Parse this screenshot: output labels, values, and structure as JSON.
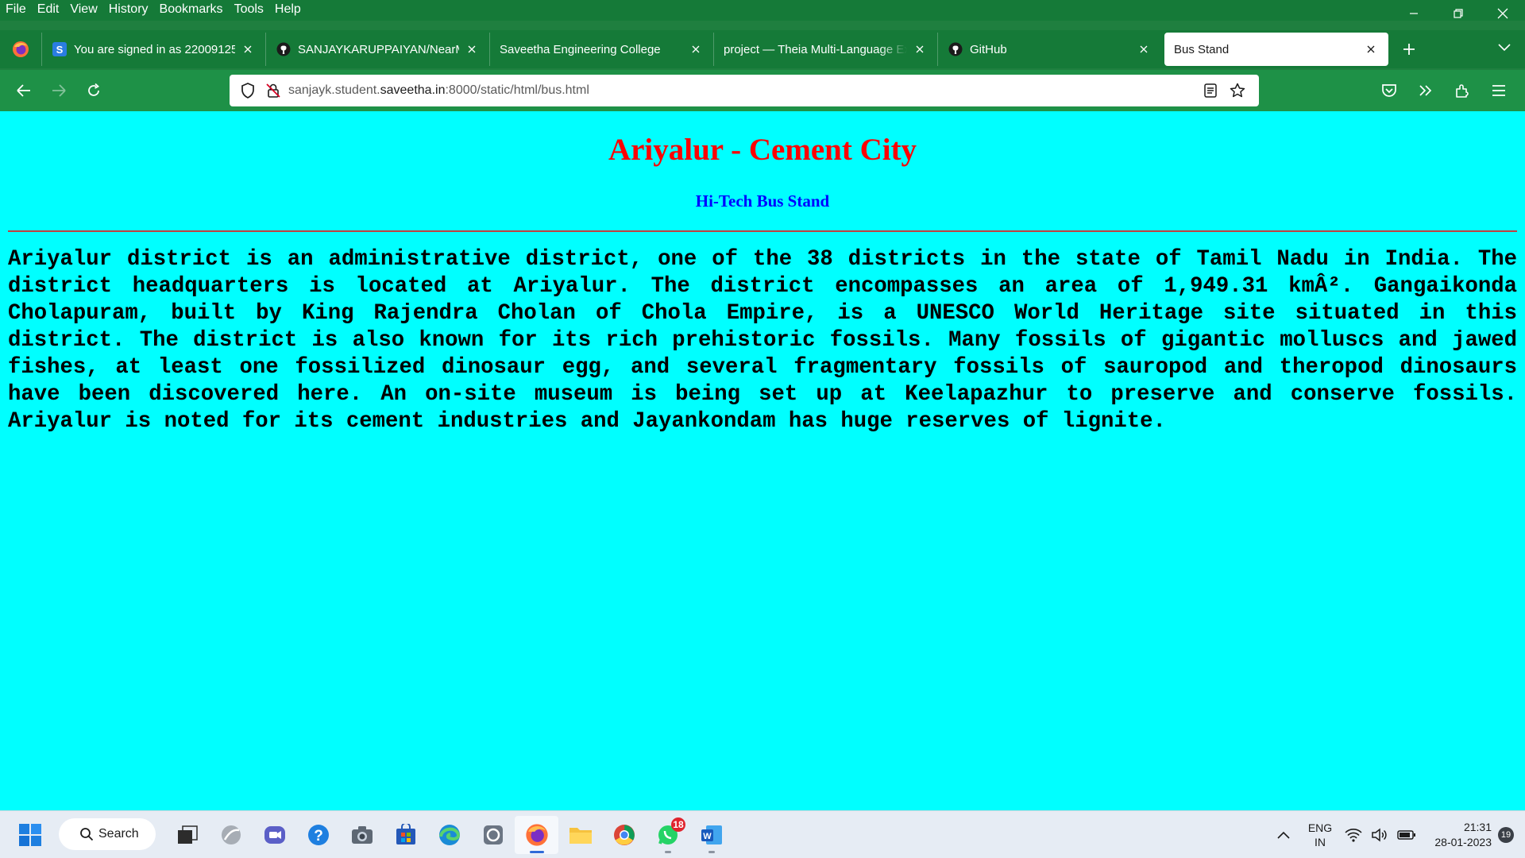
{
  "menu": {
    "items": [
      {
        "label": "File"
      },
      {
        "label": "Edit"
      },
      {
        "label": "View"
      },
      {
        "label": "History"
      },
      {
        "label": "Bookmarks"
      },
      {
        "label": "Tools"
      },
      {
        "label": "Help"
      }
    ]
  },
  "tabs": [
    {
      "title": "You are signed in as 22009125",
      "icon": "s-icon"
    },
    {
      "title": "SANJAYKARUPPAIYAN/NearMe",
      "icon": "github-icon"
    },
    {
      "title": "Saveetha Engineering College",
      "icon": "none"
    },
    {
      "title": "project — Theia Multi-Language Ex",
      "icon": "none"
    },
    {
      "title": "GitHub",
      "icon": "github-icon"
    },
    {
      "title": "Bus Stand",
      "icon": "none",
      "active": true
    }
  ],
  "urlbar": {
    "url_prefix": "sanjayk.student.",
    "url_host": "saveetha.in",
    "url_suffix": ":8000/static/html/bus.html"
  },
  "page": {
    "heading": "Ariyalur - Cement City",
    "subheading": "Hi-Tech Bus Stand",
    "paragraph": "Ariyalur district is an administrative district, one of the 38 districts in the state of Tamil Nadu in India. The district headquarters is located at Ariyalur. The district encompasses an area of 1,949.31 kmÂ². Gangaikonda Cholapuram, built by King Rajendra Cholan of Chola Empire, is a UNESCO World Heritage site situated in this district. The district is also known for its rich prehistoric fossils. Many fossils of gigantic molluscs and jawed fishes, at least one fossilized dinosaur egg, and several fragmentary fossils of sauropod and theropod dinosaurs have been discovered here. An on-site museum is being set up at Keelapazhur to preserve and conserve fossils. Ariyalur is noted for its cement industries and Jayankondam has huge reserves of lignite.",
    "background": "#00ffff",
    "heading_color": "#ff0000",
    "subheading_color": "#0000ff"
  },
  "taskbar": {
    "search_label": "Search",
    "whatsapp_badge": "18",
    "lang_line1": "ENG",
    "lang_line2": "IN",
    "time": "21:31",
    "date": "28-01-2023",
    "notifications": "19"
  },
  "colors": {
    "chrome_green": "#157a38",
    "nav_green": "#1e9147"
  }
}
